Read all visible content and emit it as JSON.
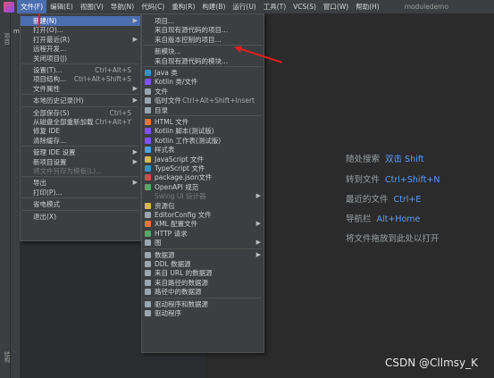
{
  "menubar": {
    "items": [
      "文件(F)",
      "编辑(E)",
      "视图(V)",
      "导航(N)",
      "代码(C)",
      "重构(R)",
      "构建(B)",
      "运行(U)",
      "工具(T)",
      "VCS(S)",
      "窗口(W)",
      "帮助(H)"
    ],
    "project": "moduledemo"
  },
  "panel": {
    "tab": "mod",
    "strip_top": "项目",
    "strip_bottom": "结构"
  },
  "file_menu": [
    {
      "label": "新建(N)",
      "arrow": true,
      "highlight": true
    },
    {
      "label": "打开(O)..."
    },
    {
      "label": "打开最近(R)",
      "arrow": true
    },
    {
      "label": "远程开发..."
    },
    {
      "label": "关闭项目(J)"
    },
    {
      "sep": true
    },
    {
      "label": "设置(T)...",
      "shortcut": "Ctrl+Alt+S"
    },
    {
      "label": "项目结构...",
      "shortcut": "Ctrl+Alt+Shift+S"
    },
    {
      "label": "文件属性",
      "arrow": true
    },
    {
      "sep": true
    },
    {
      "label": "本地历史记录(H)",
      "arrow": true
    },
    {
      "sep": true
    },
    {
      "label": "全部保存(S)",
      "shortcut": "Ctrl+S"
    },
    {
      "label": "从磁盘全部重新加载",
      "shortcut": "Ctrl+Alt+Y"
    },
    {
      "label": "修复 IDE"
    },
    {
      "label": "清除缓存..."
    },
    {
      "sep": true
    },
    {
      "label": "管理 IDE 设置",
      "arrow": true
    },
    {
      "label": "新项目设置",
      "arrow": true
    },
    {
      "label": "将文件另存为模板(L)...",
      "disabled": true
    },
    {
      "sep": true
    },
    {
      "label": "导出",
      "arrow": true
    },
    {
      "label": "打印(P)..."
    },
    {
      "sep": true
    },
    {
      "label": "省电模式"
    },
    {
      "sep": true
    },
    {
      "label": "退出(X)"
    }
  ],
  "new_menu": [
    {
      "label": "项目..."
    },
    {
      "label": "来自现有源代码的项目..."
    },
    {
      "label": "来自版本控制的项目..."
    },
    {
      "sep": true
    },
    {
      "label": "新模块..."
    },
    {
      "label": "来自现有源代码的模块..."
    },
    {
      "sep": true
    },
    {
      "label": "Java 类",
      "icon": "#3592c4"
    },
    {
      "label": "Kotlin 类/文件",
      "icon": "#7f52ff"
    },
    {
      "label": "文件",
      "icon": "#9aa7b0"
    },
    {
      "label": "临时文件",
      "shortcut": "Ctrl+Alt+Shift+Insert",
      "icon": "#9aa7b0"
    },
    {
      "label": "目录",
      "icon": "#9aa7b0"
    },
    {
      "sep": true
    },
    {
      "label": "HTML 文件",
      "icon": "#e8743c"
    },
    {
      "label": "Kotlin 脚本(测试版)",
      "icon": "#7f52ff"
    },
    {
      "label": "Kotlin 工作表(测试版)",
      "icon": "#7f52ff"
    },
    {
      "label": "样式表",
      "icon": "#4aa3df"
    },
    {
      "label": "JavaScript 文件",
      "icon": "#d6b94a"
    },
    {
      "label": "TypeScript 文件",
      "icon": "#3592c4"
    },
    {
      "label": "package.json文件",
      "icon": "#c94e4e"
    },
    {
      "label": "OpenAPI 规范",
      "icon": "#59a869"
    },
    {
      "label": "Swing UI 设计器",
      "arrow": true,
      "disabled": true
    },
    {
      "label": "资源包",
      "icon": "#d6b94a"
    },
    {
      "label": "EditorConfig 文件",
      "icon": "#9aa7b0"
    },
    {
      "label": "XML 配置文件",
      "arrow": true,
      "icon": "#e8743c"
    },
    {
      "label": "HTTP 请求",
      "icon": "#59a869"
    },
    {
      "label": "图",
      "arrow": true,
      "icon": "#9aa7b0"
    },
    {
      "sep": true
    },
    {
      "label": "数据源",
      "arrow": true,
      "icon": "#9aa7b0"
    },
    {
      "label": "DDL 数据源",
      "icon": "#9aa7b0"
    },
    {
      "label": "来自 URL 的数据源",
      "icon": "#9aa7b0"
    },
    {
      "label": "来自路径的数据源",
      "icon": "#9aa7b0"
    },
    {
      "label": "路径中的数据源",
      "icon": "#9aa7b0"
    },
    {
      "sep": true
    },
    {
      "label": "驱动程序和数据源",
      "icon": "#9aa7b0"
    },
    {
      "label": "驱动程序",
      "icon": "#9aa7b0"
    }
  ],
  "hints": [
    {
      "text": "随处搜索",
      "key": "双击 Shift"
    },
    {
      "text": "转到文件",
      "key": "Ctrl+Shift+N"
    },
    {
      "text": "最近的文件",
      "key": "Ctrl+E"
    },
    {
      "text": "导航栏",
      "key": "Alt+Home"
    },
    {
      "text": "将文件拖放到此处以打开",
      "key": ""
    }
  ],
  "watermark": "CSDN @Cllmsy_K",
  "colors": {
    "menubar": "#3c3f41",
    "highlight": "#4b6eaf",
    "editor": "#2b2b2b",
    "hint_key": "#589df6",
    "annotation": "#e02020"
  }
}
